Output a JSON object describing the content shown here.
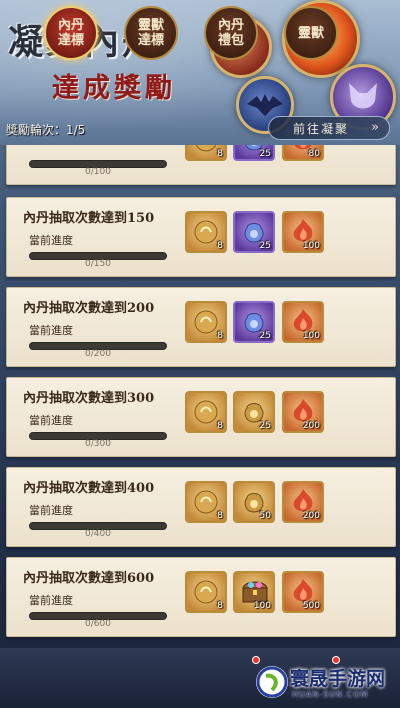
{
  "header": {
    "title_main": "凝聚內丹",
    "title_sub": "達成獎勵",
    "round_label": "獎勵輪次：1/5",
    "goto_button": "前往凝聚"
  },
  "cards": [
    {
      "title": "",
      "progress_label": "",
      "progress_text": "0/100",
      "progress": 0,
      "rewards": [
        {
          "icon": "gold-pouch-icon",
          "count": "8",
          "style": "gold"
        },
        {
          "icon": "blue-bag-icon",
          "count": "25",
          "style": "purple"
        },
        {
          "icon": "red-flame-icon",
          "count": "80",
          "style": "orange"
        }
      ]
    },
    {
      "title": "內丹抽取次數達到150",
      "progress_label": "當前進度",
      "progress_text": "0/150",
      "progress": 0,
      "rewards": [
        {
          "icon": "gold-pouch-icon",
          "count": "8",
          "style": "gold"
        },
        {
          "icon": "blue-bag-icon",
          "count": "25",
          "style": "purple"
        },
        {
          "icon": "red-flame-icon",
          "count": "100",
          "style": "orange"
        }
      ]
    },
    {
      "title": "內丹抽取次數達到200",
      "progress_label": "當前進度",
      "progress_text": "0/200",
      "progress": 0,
      "rewards": [
        {
          "icon": "gold-pouch-icon",
          "count": "8",
          "style": "gold"
        },
        {
          "icon": "blue-bag-icon",
          "count": "25",
          "style": "purple"
        },
        {
          "icon": "red-flame-icon",
          "count": "100",
          "style": "orange"
        }
      ]
    },
    {
      "title": "內丹抽取次數達到300",
      "progress_label": "當前進度",
      "progress_text": "0/300",
      "progress": 0,
      "rewards": [
        {
          "icon": "gold-pouch-icon",
          "count": "8",
          "style": "gold"
        },
        {
          "icon": "gold-bag-icon",
          "count": "25",
          "style": "gold"
        },
        {
          "icon": "red-flame-icon",
          "count": "200",
          "style": "orange"
        }
      ]
    },
    {
      "title": "內丹抽取次數達到400",
      "progress_label": "當前進度",
      "progress_text": "0/400",
      "progress": 0,
      "rewards": [
        {
          "icon": "gold-pouch-icon",
          "count": "8",
          "style": "gold"
        },
        {
          "icon": "gold-bag-icon",
          "count": "50",
          "style": "gold"
        },
        {
          "icon": "red-flame-icon",
          "count": "200",
          "style": "orange"
        }
      ]
    },
    {
      "title": "內丹抽取次數達到600",
      "progress_label": "當前進度",
      "progress_text": "0/600",
      "progress": 0,
      "rewards": [
        {
          "icon": "gold-pouch-icon",
          "count": "8",
          "style": "gold"
        },
        {
          "icon": "treasure-chest-icon",
          "count": "100",
          "style": "gold"
        },
        {
          "icon": "red-flame-icon",
          "count": "500",
          "style": "orange"
        }
      ]
    }
  ],
  "nav": [
    {
      "label": "內丹達標",
      "active": true
    },
    {
      "label": "靈獸達標",
      "active": false
    },
    {
      "label": "內丹禮包",
      "active": false
    },
    {
      "label": "靈獸",
      "active": false
    }
  ],
  "watermark": {
    "text": "寰晟手游网",
    "url": "HUAN-SUN.COM"
  },
  "colors": {
    "card_bg": "#f1e8d6",
    "accent_red": "#8f1a1a",
    "gold": "#c9a45a"
  }
}
